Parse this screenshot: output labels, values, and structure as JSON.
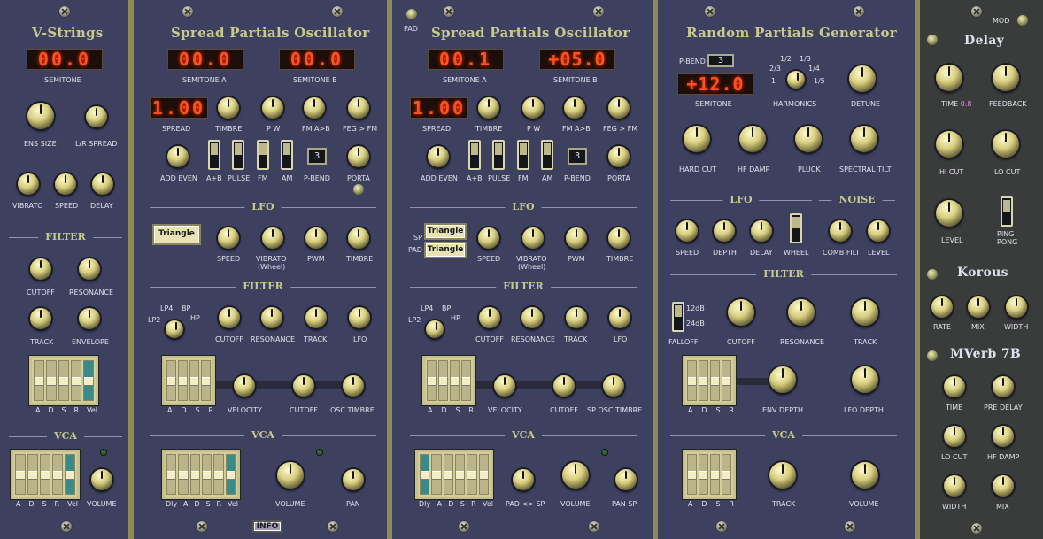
{
  "vstrings": {
    "title": "V-Strings",
    "led": "00.0",
    "semitone": "SEMITONE",
    "ens_size": "ENS SIZE",
    "lr_spread": "L/R SPREAD",
    "vibrato": "VIBRATO",
    "speed": "SPEED",
    "delay": "DELAY",
    "filter": "FILTER",
    "cutoff": "CUTOFF",
    "resonance": "RESONANCE",
    "track": "TRACK",
    "envelope": "ENVELOPE",
    "adsr_vel": [
      "A",
      "D",
      "S",
      "R",
      "Vel"
    ],
    "vca": "VCA",
    "volume": "VOLUME"
  },
  "spo1": {
    "title": "Spread Partials Oscillator",
    "led_a": "00.0",
    "led_b": "00.0",
    "semitone_a": "SEMITONE A",
    "semitone_b": "SEMITONE B",
    "led_spread": "1.00",
    "spread": "SPREAD",
    "timbre": "TIMBRE",
    "pw": "P W",
    "fm_ab": "FM A>B",
    "feg_fm": "FEG > FM",
    "add_even": "ADD EVEN",
    "apb": "A+B",
    "pulse": "PULSE",
    "fm": "FM",
    "am": "AM",
    "pbend_val": "3",
    "pbend": "P-BEND",
    "porta": "PORTA",
    "lfo": "LFO",
    "triangle": "Triangle",
    "speed": "SPEED",
    "vibrato": "VIBRATO",
    "wheel": "(Wheel)",
    "pwm": "PWM",
    "lfo_timbre": "TIMBRE",
    "filter": "FILTER",
    "lp4": "LP4",
    "bp": "BP",
    "lp2": "LP2",
    "hp": "HP",
    "cutoff": "CUTOFF",
    "resonance": "RESONANCE",
    "track": "TRACK",
    "flfo": "LFO",
    "adsr": [
      "A",
      "D",
      "S",
      "R"
    ],
    "velocity": "VELOCITY",
    "cutoff2": "CUTOFF",
    "osc_timbre": "OSC TIMBRE",
    "vca": "VCA",
    "adsr2": [
      "Dly",
      "A",
      "D",
      "S",
      "R",
      "Vel"
    ],
    "volume": "VOLUME",
    "pan": "PAN",
    "info": "INFO"
  },
  "spo2": {
    "pad": "PAD",
    "title": "Spread Partials Oscillator",
    "led_a": "00.1",
    "led_b": "+05.0",
    "semitone_a": "SEMITONE A",
    "semitone_b": "SEMITONE B",
    "led_spread": "1.00",
    "spread": "SPREAD",
    "timbre": "TIMBRE",
    "pw": "P W",
    "fm_ab": "FM A>B",
    "feg_fm": "FEG > FM",
    "add_even": "ADD EVEN",
    "apb": "A+B",
    "pulse": "PULSE",
    "fm": "FM",
    "am": "AM",
    "pbend_val": "3",
    "pbend": "P-BEND",
    "porta": "PORTA",
    "lfo": "LFO",
    "sp": "SP",
    "padl": "PAD",
    "triangle": "Triangle",
    "speed": "SPEED",
    "vibrato": "VIBRATO",
    "wheel": "(Wheel)",
    "pwm": "PWM",
    "lfo_timbre": "TIMBRE",
    "filter": "FILTER",
    "lp4": "LP4",
    "bp": "BP",
    "lp2": "LP2",
    "hp": "HP",
    "cutoff": "CUTOFF",
    "resonance": "RESONANCE",
    "track": "TRACK",
    "flfo": "LFO",
    "adsr": [
      "A",
      "D",
      "S",
      "R"
    ],
    "velocity": "VELOCITY",
    "cutoff2": "CUTOFF",
    "sp_osc_timbre": "SP OSC TIMBRE",
    "vca": "VCA",
    "adsr2": [
      "Dly",
      "A",
      "D",
      "S",
      "R",
      "Vel"
    ],
    "pad_sp": "PAD <> SP",
    "volume": "VOLUME",
    "pan_sp": "PAN SP"
  },
  "rpg": {
    "title": "Random Partials Generator",
    "pbend": "P-BEND",
    "pbend_val": "3",
    "led": "+12.0",
    "semitone": "SEMITONE",
    "harm": [
      "1/2",
      "1/3",
      "2/3",
      "1/4",
      "1",
      "1/5"
    ],
    "harmonics": "HARMONICS",
    "detune": "DETUNE",
    "hard_cut": "HARD CUT",
    "hf_damp": "HF DAMP",
    "pluck": "PLUCK",
    "spectral_tilt": "SPECTRAL TILT",
    "lfo": "LFO",
    "noise": "NOISE",
    "speed": "SPEED",
    "depth": "DEPTH",
    "delay": "DELAY",
    "wheel": "WHEEL",
    "comb_filt": "COMB FILT",
    "level": "LEVEL",
    "filter": "FILTER",
    "db12": "12dB",
    "db24": "24dB",
    "falloff": "FALLOFF",
    "cutoff": "CUTOFF",
    "resonance": "RESONANCE",
    "track": "TRACK",
    "adsr": [
      "A",
      "D",
      "S",
      "R"
    ],
    "env_depth": "ENV DEPTH",
    "lfo_depth": "LFO DEPTH",
    "vca": "VCA",
    "adsr2": [
      "A",
      "D",
      "S",
      "R"
    ],
    "vtrack": "TRACK",
    "volume": "VOLUME"
  },
  "fx": {
    "mod": "MOD",
    "delay": "Delay",
    "time": "TIME",
    "time_val": "0.8",
    "feedback": "FEEDBACK",
    "hi_cut": "HI CUT",
    "lo_cut": "LO CUT",
    "level": "LEVEL",
    "ping": "PING",
    "pong": "PONG",
    "korous": "Korous",
    "rate": "RATE",
    "mix": "MIX",
    "width": "WIDTH",
    "mverb": "MVerb 7B",
    "m_time": "TIME",
    "pre_delay": "PRE DELAY",
    "m_lo_cut": "LO CUT",
    "hf_damp": "HF DAMP",
    "m_width": "WIDTH",
    "m_mix": "MIX"
  }
}
